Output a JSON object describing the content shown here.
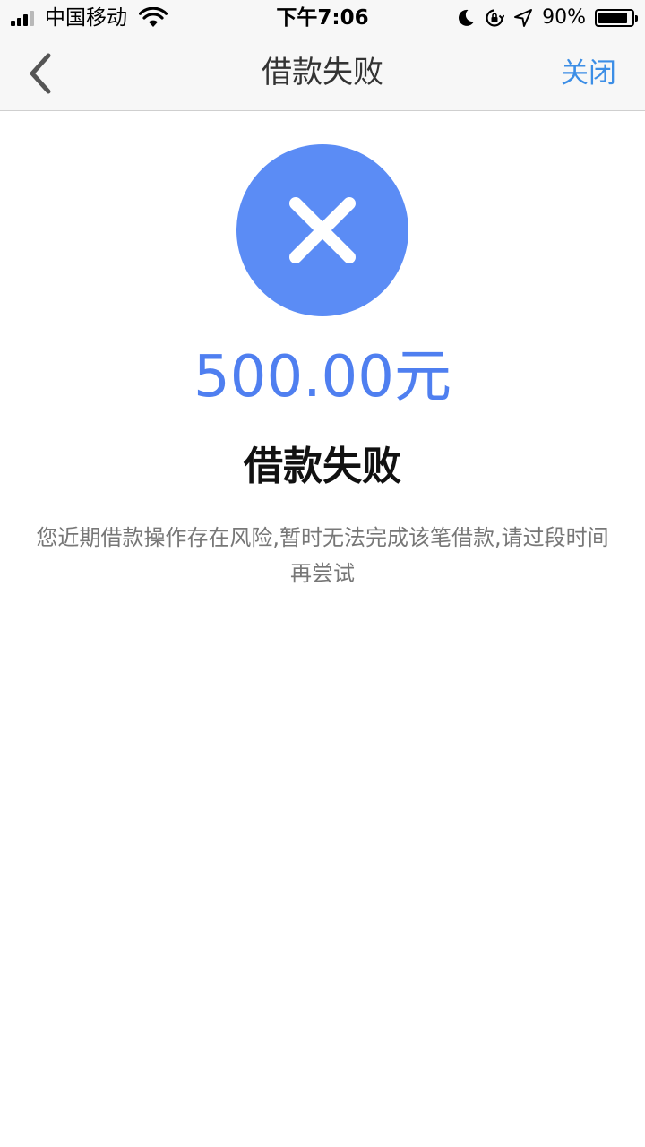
{
  "status_bar": {
    "carrier": "中国移动",
    "time": "下午7:06",
    "battery_percent": "90%",
    "battery_level": 0.9,
    "icons": [
      "signal-icon",
      "wifi-icon",
      "moon-icon",
      "orientation-lock-icon",
      "location-icon",
      "battery-icon"
    ]
  },
  "nav": {
    "title": "借款失败",
    "close_label": "关闭",
    "back_icon": "chevron-left-icon"
  },
  "result": {
    "icon": "close-x-icon",
    "amount": "500.00元",
    "title": "借款失败",
    "message": "您近期借款操作存在风险,暂时无法完成该笔借款,请过段时间再尝试"
  },
  "colors": {
    "accent": "#5b8cf5",
    "amount": "#4f7ff0",
    "link": "#3c8ee6",
    "title_text": "#111111",
    "secondary_text": "#777777",
    "nav_background": "#f7f7f7"
  }
}
